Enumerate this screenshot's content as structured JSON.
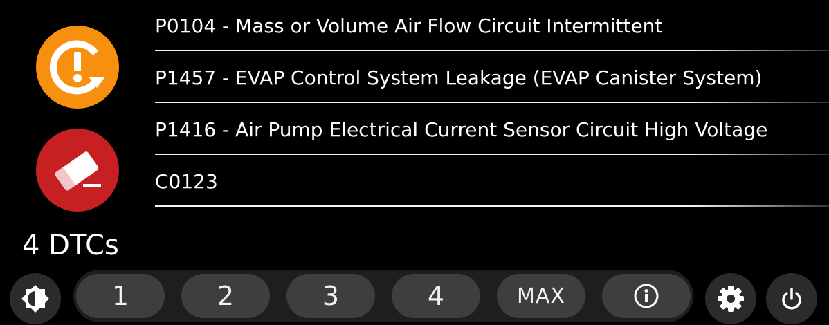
{
  "actions": {
    "refresh_icon": "refresh-warning-icon",
    "refresh_color": "#f7900f",
    "clear_icon": "eraser-icon",
    "clear_color": "#c62022"
  },
  "dtcs": [
    {
      "text": "P0104 - Mass or Volume Air Flow Circuit Intermittent"
    },
    {
      "text": "P1457 - EVAP Control System Leakage (EVAP Canister System)"
    },
    {
      "text": "P1416 - Air Pump Electrical Current Sensor Circuit High Voltage"
    },
    {
      "text": "C0123"
    }
  ],
  "summary": {
    "count_label": "4 DTCs"
  },
  "toolbar": {
    "brightness_icon": "brightness-icon",
    "modes": [
      "1",
      "2",
      "3",
      "4",
      "MAX"
    ],
    "info_icon": "info-icon",
    "settings_icon": "gear-icon",
    "power_icon": "power-icon"
  }
}
